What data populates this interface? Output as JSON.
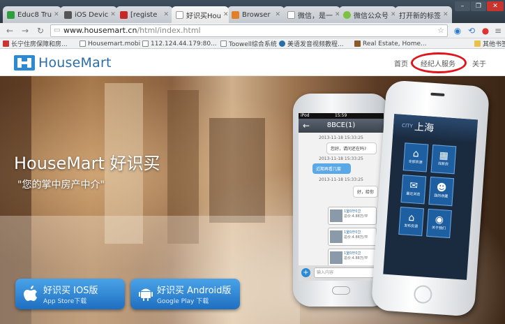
{
  "browser": {
    "tabs": [
      {
        "title": "Educ8 Tru",
        "color": "#2f9e3f"
      },
      {
        "title": "iOS Devic",
        "color": "#555555"
      },
      {
        "title": "[registe",
        "color": "#c62828"
      },
      {
        "title": "好识买Hou",
        "color": "#ffffff"
      },
      {
        "title": "Browser",
        "color": "#e0812a"
      },
      {
        "title": "微信，是一",
        "color": "#ffffff"
      },
      {
        "title": "微信公众号",
        "color": "#7cc142"
      },
      {
        "title": "打开新的标签",
        "color": "#ffffff"
      }
    ],
    "address": {
      "host": "www.housemart.cn",
      "path": "/html/index.html"
    },
    "bookmarks": [
      {
        "label": "长宁住房保障和房..."
      },
      {
        "label": "Housemart.mobi"
      },
      {
        "label": "112.124.44.179:80..."
      },
      {
        "label": "Toowell综合系统"
      },
      {
        "label": "美语发音视频教程..."
      },
      {
        "label": "Real Estate, Home..."
      },
      {
        "label": "其他书签"
      }
    ]
  },
  "site": {
    "logo": "HouseMart",
    "nav": [
      {
        "label": "首页"
      },
      {
        "label": "经纪人服务"
      },
      {
        "label": "关于"
      }
    ],
    "hero": {
      "title": "HouseMart 好识买",
      "subtitle": "\"您的掌中房产中介\""
    },
    "buttons": [
      {
        "title": "好识买 IOS版",
        "sub": "App Store下载"
      },
      {
        "title": "好识买 Android版",
        "sub": "Google Play  下载"
      }
    ]
  },
  "phone_left": {
    "status": "iPod",
    "time": "15:59",
    "header": "8BCE(1)",
    "messages": [
      {
        "stamp": "2013-11-18 15:33:25"
      },
      {
        "text": "您好，请问还在吗?"
      },
      {
        "stamp": "2013-11-18 15:33:25"
      },
      {
        "text": "近期再看几套"
      },
      {
        "stamp": "2013-11-18 15:33:25"
      },
      {
        "text": "好，给你"
      }
    ],
    "cards": [
      {
        "line1": "1室0厅0卫",
        "line2": "总价:4.88万/平"
      },
      {
        "line1": "1室0厅0卫",
        "line2": "总价:4.88万/平"
      },
      {
        "line1": "1室0厅0卫",
        "line2": "总价:4.88万/平"
      }
    ],
    "input_placeholder": "输入内容"
  },
  "phone_right": {
    "city_label": "CITY",
    "city": "上海",
    "tiles": [
      {
        "label": "全部房源"
      },
      {
        "label": "找新房"
      },
      {
        "label": "最近浏览"
      },
      {
        "label": "我的收藏"
      },
      {
        "label": "发布房源"
      },
      {
        "label": "关于我们"
      }
    ]
  }
}
